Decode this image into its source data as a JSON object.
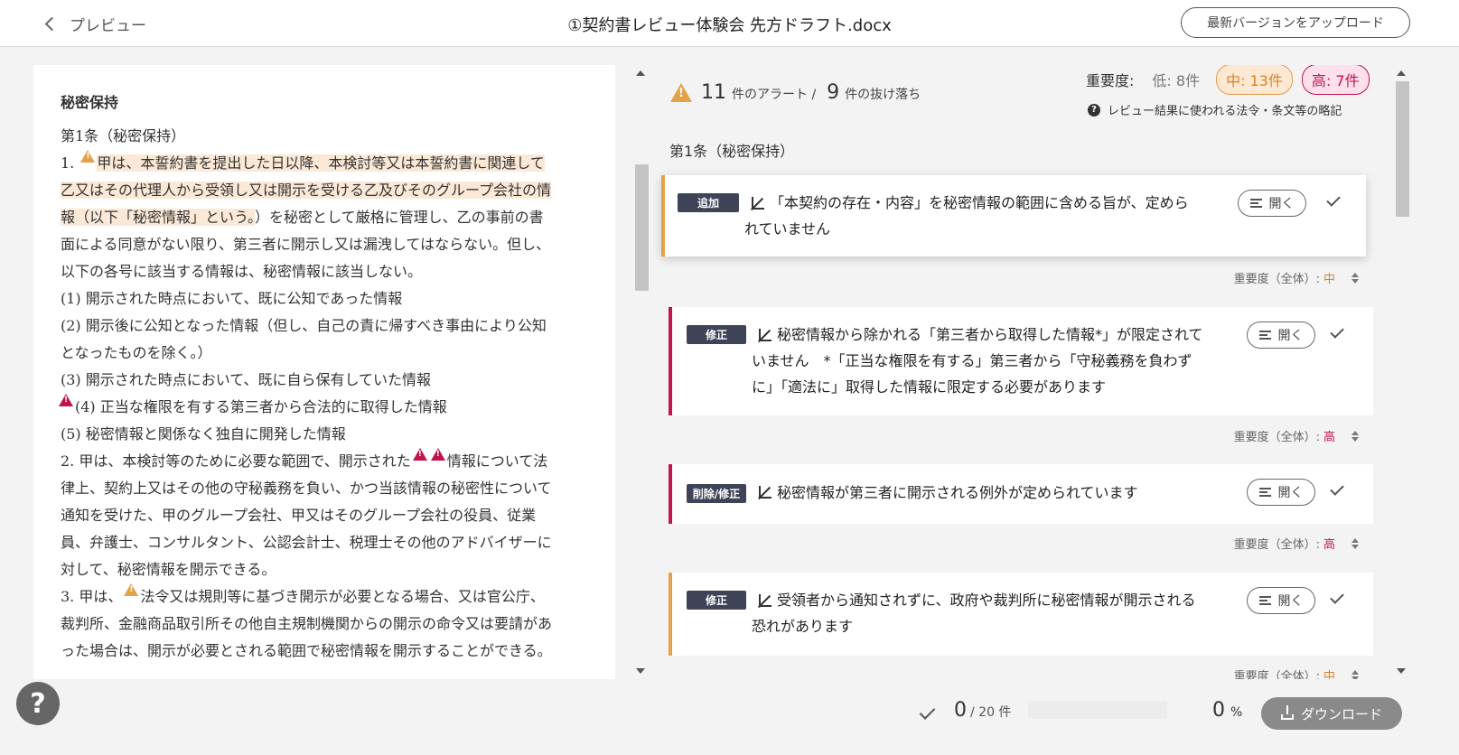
{
  "header": {
    "back_label": "プレビュー",
    "doc_title": "①契約書レビュー体験会 先方ドラフト.docx",
    "upload_label": "最新バージョンをアップロード"
  },
  "document": {
    "heading": "秘密保持",
    "lines": {
      "l1": "第1条（秘密保持）",
      "l2a": "1. ",
      "l2b": "甲は、本誓約書を提出した日以降、本検討等又は本誓約書に関連して",
      "l3": "乙又はその代理人から受領し又は開示を受ける乙及びそのグループ会社の情",
      "l4a": "報（以下「秘密情報」という。",
      "l4b": "）を秘密として厳格に管理し、乙の事前の書",
      "l5": "面による同意がない限り、第三者に開示し又は漏洩してはならない。但し、",
      "l6": "以下の各号に該当する情報は、秘密情報に該当しない。",
      "l7": "(1) 開示された時点において、既に公知であった情報",
      "l8": "(2) 開示後に公知となった情報（但し、自己の責に帰すべき事由により公知",
      "l9": "となったものを除く。）",
      "l10": "(3) 開示された時点において、既に自ら保有していた情報",
      "l11": "(4) 正当な権限を有する第三者から合法的に取得した情報",
      "l12": "(5) 秘密情報と関係なく独自に開発した情報",
      "l13a": "2. 甲は、本検討等のために必要な範囲で、開示された",
      "l13b": "情報について法",
      "l14": "律上、契約上又はその他の守秘義務を負い、かつ当該情報の秘密性について",
      "l15": "通知を受けた、甲のグループ会社、甲又はそのグループ会社の役員、従業",
      "l16": "員、弁護士、コンサルタント、公認会計士、税理士その他のアドバイザーに",
      "l17": "対して、秘密情報を開示できる。",
      "l18a": "3. 甲は、",
      "l18b": "法令又は規則等に基づき開示が必要となる場合、又は官公庁、",
      "l19": "裁判所、金融商品取引所その他自主規制機関からの開示の命令又は要請があ",
      "l20": "った場合は、開示が必要とされる範囲で秘密情報を開示することができる。"
    }
  },
  "review": {
    "alert_count": "11",
    "alert_label": "件のアラート /",
    "missing_count": "9",
    "missing_label": "件の抜け落ち",
    "severity_label": "重要度:",
    "severity_low": "低: 8件",
    "severity_mid": "中: 13件",
    "severity_high": "高: 7件",
    "legend_link": "レビュー結果に使われる法令・条文等の略記",
    "section_title": "第1条（秘密保持）",
    "open_label": "開く",
    "sev_prefix": "重要度（全体）:",
    "cards": [
      {
        "tag": "追加",
        "text1": "「本契約の存在・内容」を秘密情報の範囲に含める旨が、定めら",
        "text2": "れていません",
        "text3": "",
        "severity": "中"
      },
      {
        "tag": "修正",
        "text1": "秘密情報から除かれる「第三者から取得した情報*」が限定されて",
        "text2": "いません　*「正当な権限を有する」第三者から「守秘義務を負わず",
        "text3": "に」「適法に」取得した情報に限定する必要があります",
        "severity": "高"
      },
      {
        "tag": "削除/修正",
        "text1": "秘密情報が第三者に開示される例外が定められています",
        "text2": "",
        "text3": "",
        "severity": "高"
      },
      {
        "tag": "修正",
        "text1": "受領者から通知されずに、政府や裁判所に秘密情報が開示される",
        "text2": "恐れがあります",
        "text3": "",
        "severity": "中"
      }
    ]
  },
  "footer": {
    "help_label": "?",
    "done_count": "0",
    "total_label": "/ 20 件",
    "percent_value": "0",
    "percent_unit": "%",
    "progress_fraction": 0,
    "download_label": "ダウンロード"
  },
  "colors": {
    "accent_mid": "#e4a04a",
    "accent_high": "#c0134f",
    "tag_bg": "#3e4357"
  }
}
